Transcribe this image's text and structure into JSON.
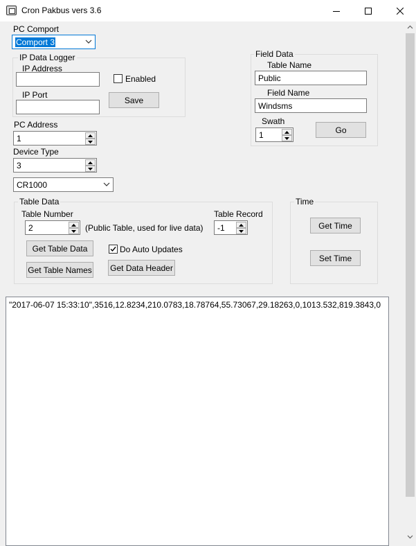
{
  "window": {
    "title": "Cron Pakbus vers 3.6",
    "controls": {
      "minimize": "minimize-icon",
      "maximize": "maximize-icon",
      "close": "close-icon"
    }
  },
  "pc_comport": {
    "label": "PC Comport",
    "selected": "Comport 3"
  },
  "ip_logger": {
    "group_title": "IP Data Logger",
    "address_label": "IP Address",
    "address_value": "",
    "port_label": "IP Port",
    "port_value": "",
    "enabled_label": "Enabled",
    "enabled_checked": false,
    "save_label": "Save"
  },
  "field_data": {
    "group_title": "Field Data",
    "table_name_label": "Table Name",
    "table_name_value": "Public",
    "field_name_label": "Field Name",
    "field_name_value": "Windsms",
    "swath_label": "Swath",
    "swath_value": "1",
    "go_label": "Go"
  },
  "pc_address": {
    "label": "PC Address",
    "value": "1"
  },
  "device_type": {
    "label": "Device Type",
    "value": "3",
    "model_selected": "CR1000"
  },
  "table_data": {
    "group_title": "Table Data",
    "table_number_label": "Table Number",
    "table_number_value": "2",
    "table_number_hint": "(Public Table, used for live data)",
    "table_record_label": "Table Record",
    "table_record_value": "-1",
    "get_table_data_label": "Get Table Data",
    "do_auto_updates_label": "Do Auto Updates",
    "do_auto_updates_checked": true,
    "get_table_names_label": "Get Table Names",
    "get_data_header_label": "Get Data Header"
  },
  "time": {
    "group_title": "Time",
    "get_time_label": "Get Time",
    "set_time_label": "Set Time"
  },
  "output": {
    "text": "\"2017-06-07 15:33:10\",3516,12.8234,210.0783,18.78764,55.73067,29.18263,0,1013.532,819.3843,0"
  },
  "colors": {
    "window_bg": "#f0f0f0",
    "selection": "#0078d7",
    "button_face": "#e1e1e1"
  }
}
